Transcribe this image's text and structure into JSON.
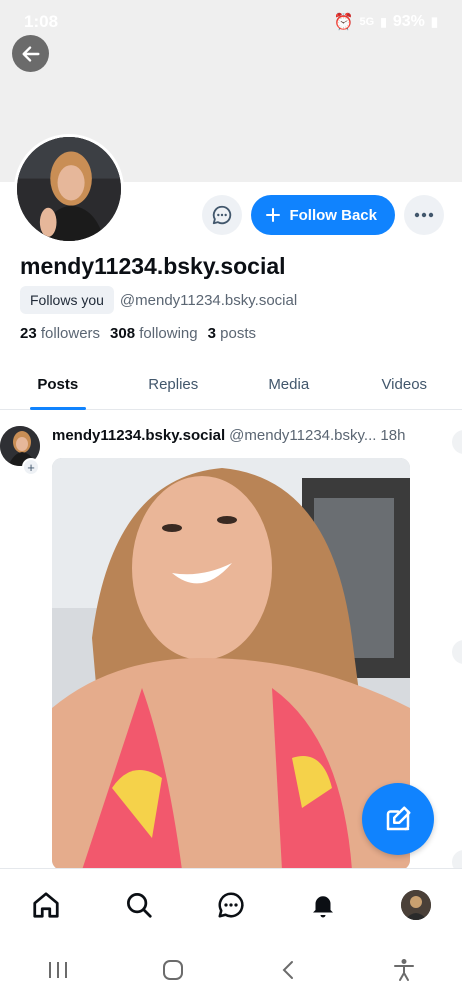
{
  "status_bar": {
    "time": "1:08",
    "battery": "93%",
    "network": "5G"
  },
  "profile": {
    "display_handle": "mendy11234.bsky.social",
    "follows_you": "Follows you",
    "handle": "@mendy11234.bsky.social",
    "followers_count": "23",
    "followers_label": "followers",
    "following_count": "308",
    "following_label": "following",
    "posts_count": "3",
    "posts_label": "posts"
  },
  "actions": {
    "follow_back_label": "Follow Back"
  },
  "tabs": [
    {
      "label": "Posts",
      "active": true
    },
    {
      "label": "Replies",
      "active": false
    },
    {
      "label": "Media",
      "active": false
    },
    {
      "label": "Videos",
      "active": false
    }
  ],
  "post": {
    "author_name": "mendy11234.bsky.social",
    "author_handle": "@mendy11234.bsky...",
    "time": "18h"
  },
  "colors": {
    "accent": "#1083fe",
    "banner": "#efefef",
    "text_muted": "#5b6673"
  },
  "icons": {
    "back": "arrow-left-icon",
    "message": "chat-bubble-icon",
    "follow": "plus-icon",
    "more": "ellipsis-icon",
    "compose": "compose-icon",
    "home": "home-icon",
    "search": "search-icon",
    "chat": "chat-icon",
    "notifications": "bell-icon"
  }
}
